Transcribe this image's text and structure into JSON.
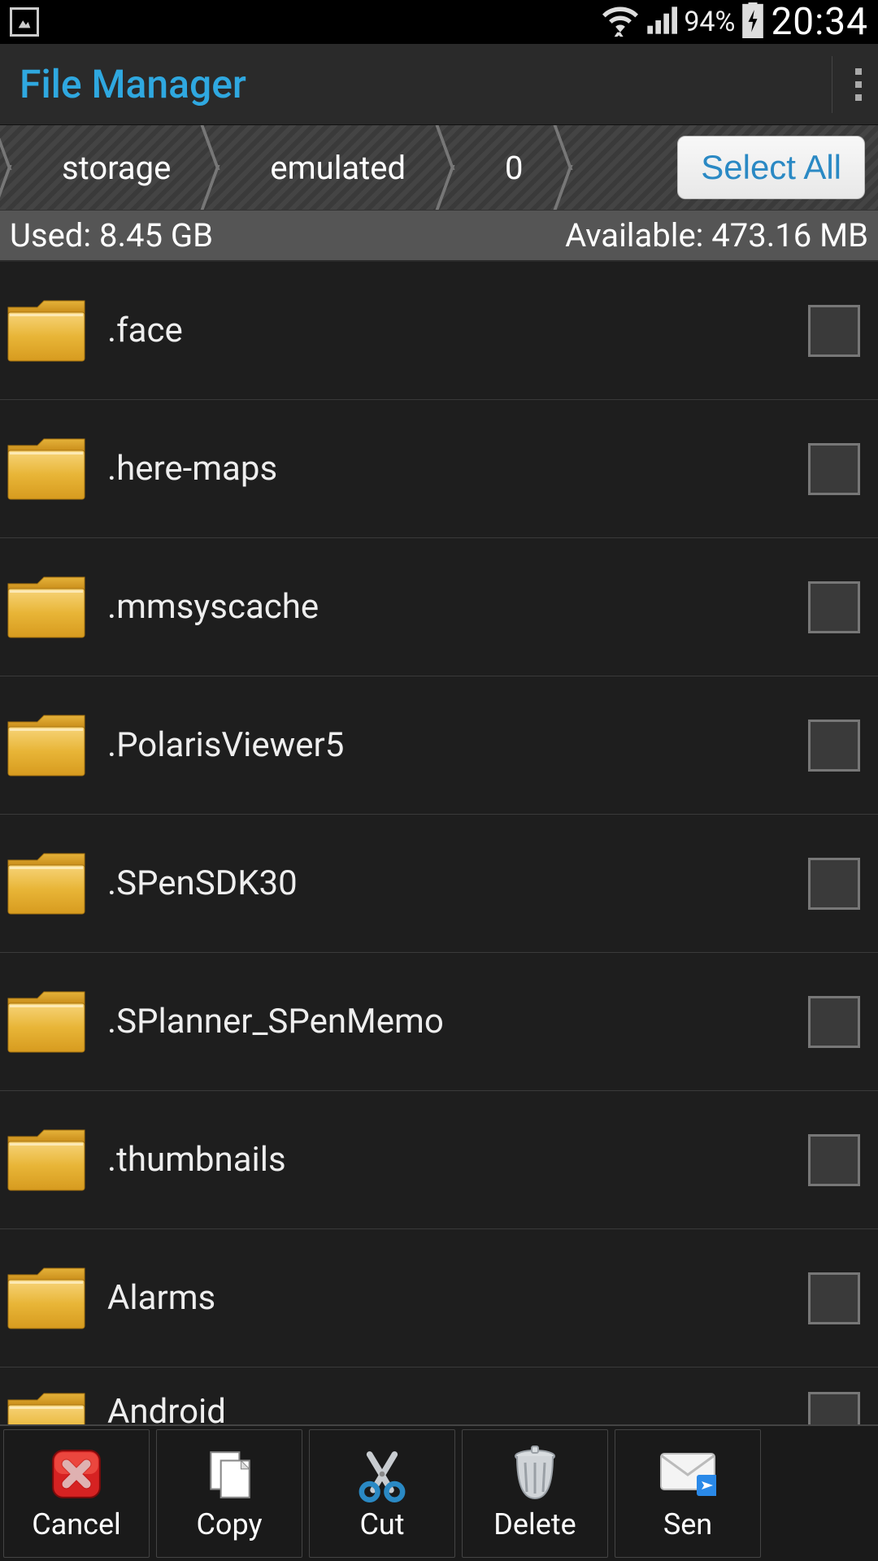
{
  "status": {
    "battery_pct": "94%",
    "time": "20:34"
  },
  "app": {
    "title": "File Manager"
  },
  "path": {
    "crumbs": [
      "storage",
      "emulated",
      "0"
    ],
    "select_all": "Select All"
  },
  "storage": {
    "used_label": "Used: 8.45 GB",
    "available_label": "Available: 473.16 MB"
  },
  "files": [
    {
      "name": ".face",
      "type": "folder",
      "checked": false
    },
    {
      "name": ".here-maps",
      "type": "folder",
      "checked": false
    },
    {
      "name": ".mmsyscache",
      "type": "folder",
      "checked": false
    },
    {
      "name": ".PolarisViewer5",
      "type": "folder",
      "checked": false
    },
    {
      "name": ".SPenSDK30",
      "type": "folder",
      "checked": false
    },
    {
      "name": ".SPlanner_SPenMemo",
      "type": "folder",
      "checked": false
    },
    {
      "name": ".thumbnails",
      "type": "folder",
      "checked": false
    },
    {
      "name": "Alarms",
      "type": "folder",
      "checked": false
    },
    {
      "name": "Android",
      "type": "folder",
      "checked": false
    }
  ],
  "actions": [
    {
      "label": "Cancel",
      "icon": "cancel"
    },
    {
      "label": "Copy",
      "icon": "copy"
    },
    {
      "label": "Cut",
      "icon": "cut"
    },
    {
      "label": "Delete",
      "icon": "delete"
    },
    {
      "label": "Sen",
      "icon": "send"
    }
  ]
}
